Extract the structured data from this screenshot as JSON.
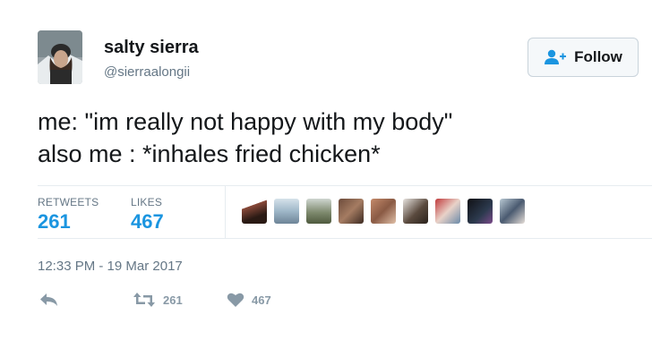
{
  "user": {
    "name": "salty sierra",
    "handle": "@sierraalongii"
  },
  "follow": {
    "label": "Follow"
  },
  "tweet": {
    "line1": "me: \"im really not happy with my body\"",
    "line2": "also me : *inhales fried chicken*"
  },
  "stats": {
    "retweets_label": "RETWEETS",
    "retweets_value": "261",
    "likes_label": "LIKES",
    "likes_value": "467"
  },
  "timestamp": "12:33 PM - 19 Mar 2017",
  "actions": {
    "retweet_count": "261",
    "like_count": "467"
  },
  "colors": {
    "accent": "#1b95e0",
    "muted": "#657786",
    "action_gray": "#8899a6"
  },
  "icons": [
    "follow-person-icon",
    "reply-icon",
    "retweet-icon",
    "heart-icon"
  ]
}
